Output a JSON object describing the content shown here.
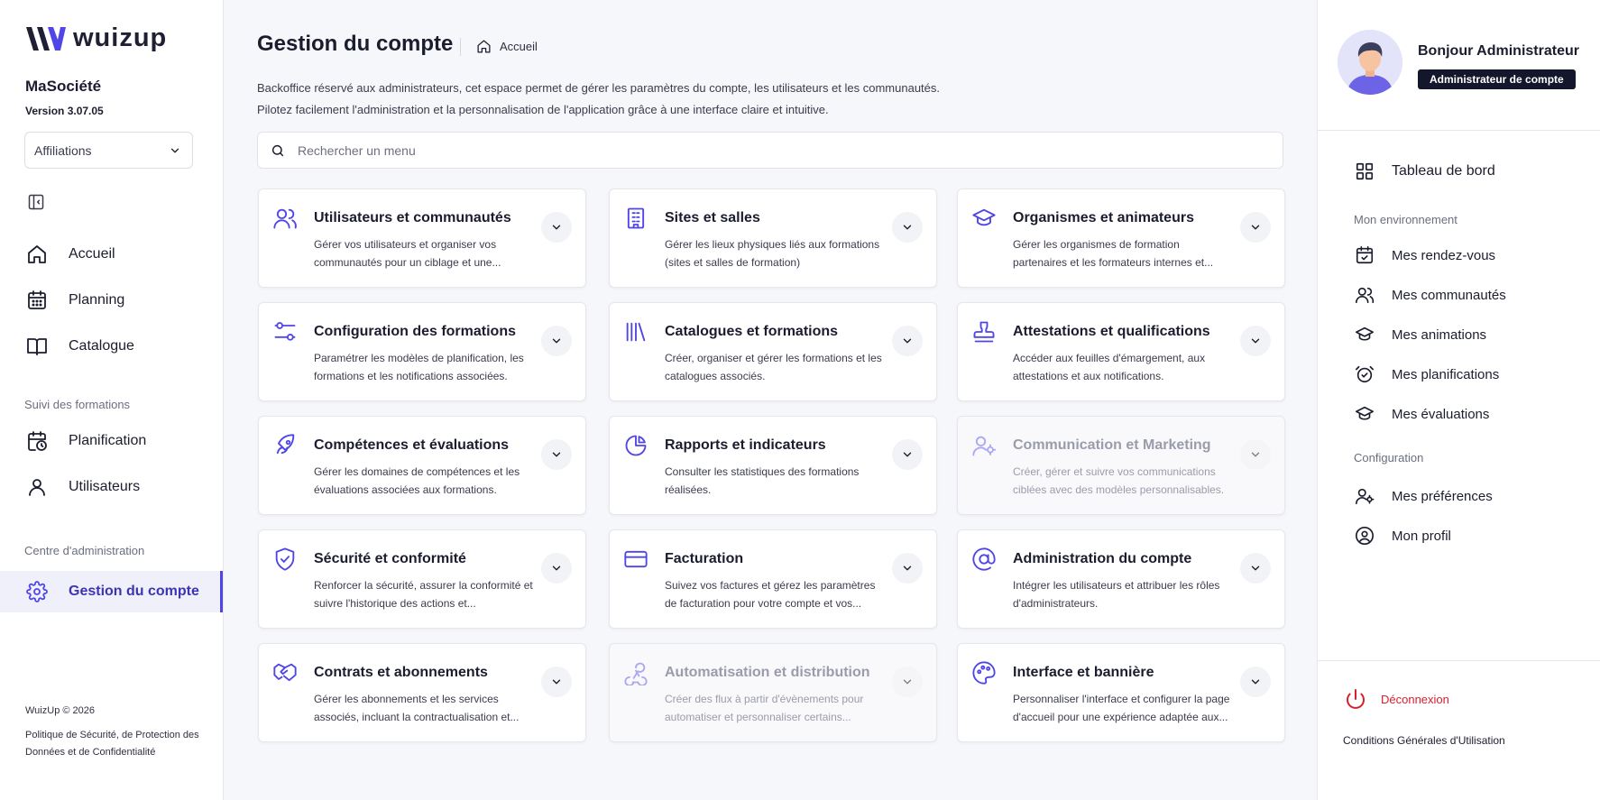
{
  "brand": {
    "name": "wuizup",
    "accent": "#4f46e5"
  },
  "sidebar": {
    "company": "MaSociété",
    "version": "Version 3.07.05",
    "select_value": "Affiliations",
    "nav": [
      {
        "label": "Accueil",
        "icon": "home-icon"
      },
      {
        "label": "Planning",
        "icon": "calendar-icon"
      },
      {
        "label": "Catalogue",
        "icon": "book-icon"
      }
    ],
    "section_suivi": "Suivi des formations",
    "suivi": [
      {
        "label": "Planification",
        "icon": "calendar-clock-icon"
      },
      {
        "label": "Utilisateurs",
        "icon": "user-icon"
      }
    ],
    "section_admin": "Centre d'administration",
    "admin_active": "Gestion du compte",
    "copyright": "WuizUp © 2026",
    "policy": "Politique de Sécurité, de Protection des Données et de Confidentialité"
  },
  "main": {
    "title": "Gestion du compte",
    "breadcrumb": "Accueil",
    "desc1": "Backoffice réservé aux administrateurs, cet espace permet de gérer les paramètres  du compte, les utilisateurs et les communautés.",
    "desc2": "Pilotez facilement l'administration et la personnalisation de l'application grâce à une interface claire et intuitive.",
    "search_placeholder": "Rechercher un menu",
    "cards": [
      {
        "title": "Utilisateurs et communautés",
        "desc": "Gérer vos utilisateurs et organiser vos communautés pour un ciblage et une...",
        "icon": "users-icon",
        "disabled": false
      },
      {
        "title": "Sites et salles",
        "desc": "Gérer les lieux physiques liés aux formations (sites et salles de formation)",
        "icon": "building-icon",
        "disabled": false
      },
      {
        "title": "Organismes et animateurs",
        "desc": "Gérer les organismes de formation partenaires et les formateurs internes et...",
        "icon": "graduation-cap-icon",
        "disabled": false
      },
      {
        "title": "Configuration des formations",
        "desc": "Paramétrer les modèles de planification, les formations et les notifications associées.",
        "icon": "sliders-icon",
        "disabled": false
      },
      {
        "title": "Catalogues et formations",
        "desc": "Créer, organiser et gérer les formations et les catalogues associés.",
        "icon": "library-icon",
        "disabled": false
      },
      {
        "title": "Attestations et qualifications",
        "desc": "Accéder aux feuilles d'émargement, aux attestations et aux notifications.",
        "icon": "stamp-icon",
        "disabled": false
      },
      {
        "title": "Compétences et évaluations",
        "desc": "Gérer les domaines de compétences et les évaluations associées aux formations.",
        "icon": "rocket-icon",
        "disabled": false
      },
      {
        "title": "Rapports et indicateurs",
        "desc": "Consulter les statistiques des formations réalisées.",
        "icon": "pie-chart-icon",
        "disabled": false
      },
      {
        "title": "Communication et Marketing",
        "desc": "Créer, gérer et suivre vos communications ciblées avec des modèles personnalisables.",
        "icon": "user-cog-icon",
        "disabled": true
      },
      {
        "title": "Sécurité et conformité",
        "desc": "Renforcer la sécurité, assurer la conformité et suivre l'historique des actions et...",
        "icon": "shield-check-icon",
        "disabled": false
      },
      {
        "title": "Facturation",
        "desc": "Suivez vos factures et gérez les paramètres de facturation pour votre compte et vos...",
        "icon": "credit-card-icon",
        "disabled": false
      },
      {
        "title": "Administration du compte",
        "desc": "Intégrer les utilisateurs et attribuer les rôles d'administrateurs.",
        "icon": "at-sign-icon",
        "disabled": false
      },
      {
        "title": "Contrats et abonnements",
        "desc": "Gérer les abonnements et les services associés, incluant la contractualisation et...",
        "icon": "handshake-icon",
        "disabled": false
      },
      {
        "title": "Automatisation et distribution",
        "desc": "Créer des flux à partir d'évènements pour automatiser et personnaliser certains...",
        "icon": "webhook-icon",
        "disabled": true
      },
      {
        "title": "Interface et bannière",
        "desc": "Personnaliser l'interface et configurer la page d'accueil pour une expérience adaptée aux...",
        "icon": "palette-icon",
        "disabled": false
      }
    ]
  },
  "right": {
    "greeting": "Bonjour Administrateur",
    "role": "Administrateur de compte",
    "dashboard": "Tableau de bord",
    "env_label": "Mon environnement",
    "env_items": [
      "Mes rendez-vous",
      "Mes communautés",
      "Mes animations",
      "Mes planifications",
      "Mes évaluations"
    ],
    "config_label": "Configuration",
    "config_items": [
      "Mes préférences",
      "Mon profil"
    ],
    "logout": "Déconnexion",
    "cgu": "Conditions Générales d'Utilisation"
  }
}
